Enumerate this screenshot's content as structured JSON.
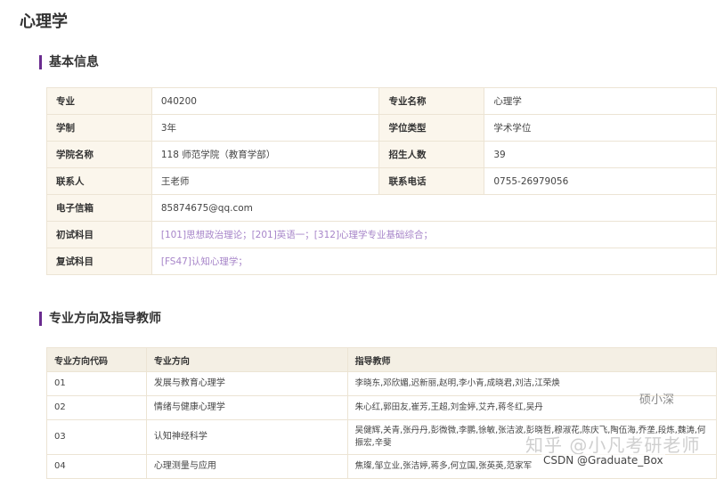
{
  "page_title": "心理学",
  "basic_section": {
    "title": "基本信息",
    "rows": [
      {
        "l1": "专业",
        "v1": "040200",
        "l2": "专业名称",
        "v2": "心理学"
      },
      {
        "l1": "学制",
        "v1": "3年",
        "l2": "学位类型",
        "v2": "学术学位"
      },
      {
        "l1": "学院名称",
        "v1": "118 师范学院（教育学部）",
        "l2": "招生人数",
        "v2": "39"
      },
      {
        "l1": "联系人",
        "v1": "王老师",
        "l2": "联系电话",
        "v2": "0755-26979056"
      }
    ],
    "email": {
      "label": "电子信箱",
      "value": "85874675@qq.com"
    },
    "initial_exam": {
      "label": "初试科目",
      "value": "[101]思想政治理论；[201]英语一；[312]心理学专业基础综合；"
    },
    "retest": {
      "label": "复试科目",
      "value": "[FS47]认知心理学；"
    }
  },
  "direction_section": {
    "title": "专业方向及指导教师",
    "headers": [
      "专业方向代码",
      "专业方向",
      "指导教师"
    ],
    "rows": [
      {
        "code": "01",
        "name": "发展与教育心理学",
        "teachers": "李晓东,邓欣媚,迟新丽,赵明,李小青,成晓君,刘洁,江荣焕"
      },
      {
        "code": "02",
        "name": "情绪与健康心理学",
        "teachers": "朱心红,郭田友,崔芳,王超,刘金婷,艾卉,蒋冬红,吴丹"
      },
      {
        "code": "03",
        "name": "认知神经科学",
        "teachers": "吴健辉,关青,张丹丹,彭微微,李鹏,徐敏,张洁波,彭晓哲,穆淑花,陈庆飞,陶伍海,乔垄,段炼,魏涛,何振宏,辛斐"
      },
      {
        "code": "04",
        "name": "心理测量与应用",
        "teachers": "焦璨,邹立业,张洁婷,蒋多,何立国,张英英,范家军"
      }
    ]
  },
  "watermarks": {
    "w1": "硕小深",
    "w2": "知乎 @小凡考研老师",
    "w3": "CSDN @Graduate_Box"
  }
}
